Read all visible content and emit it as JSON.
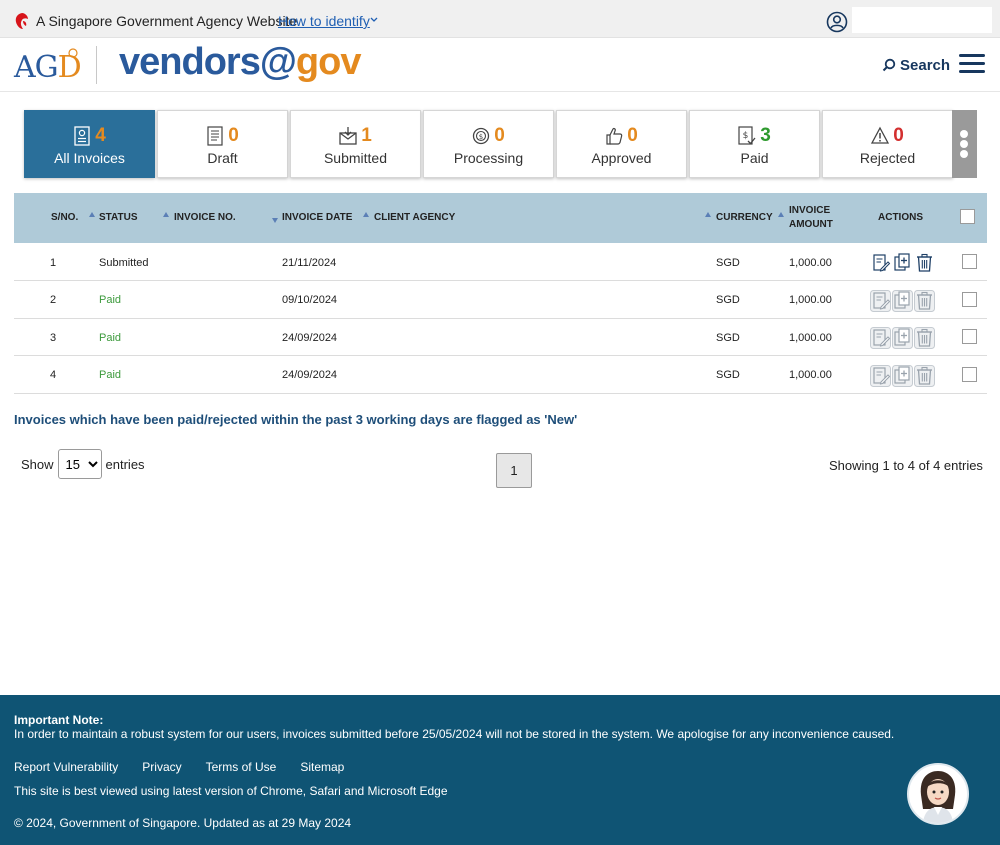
{
  "masthead": {
    "gov_text": "A Singapore Government Agency Website",
    "howto_label": "How to identify"
  },
  "header": {
    "logo_agd": "AG",
    "logo_agd_d": "D",
    "brand_part1": "vendors@",
    "brand_part2": "gov",
    "search_label": "Search"
  },
  "tabs": [
    {
      "label": "All Invoices",
      "count": "4",
      "active": true,
      "icon": "all-invoices-icon",
      "count_color": "#e48a1f"
    },
    {
      "label": "Draft",
      "count": "0",
      "icon": "draft-icon",
      "count_color": "#e48a1f"
    },
    {
      "label": "Submitted",
      "count": "1",
      "icon": "submitted-icon",
      "count_color": "#e48a1f"
    },
    {
      "label": "Processing",
      "count": "0",
      "icon": "processing-icon",
      "count_color": "#e48a1f"
    },
    {
      "label": "Approved",
      "count": "0",
      "icon": "approved-icon",
      "count_color": "#e48a1f"
    },
    {
      "label": "Paid",
      "count": "3",
      "icon": "paid-icon",
      "count_color": "#2e9a2e"
    },
    {
      "label": "Rejected",
      "count": "0",
      "icon": "rejected-icon",
      "count_color": "#d32f2f"
    }
  ],
  "table": {
    "headers": {
      "sno": "S/NO.",
      "status": "STATUS",
      "invoice_no": "INVOICE NO.",
      "invoice_date": "INVOICE DATE",
      "client_agency": "CLIENT AGENCY",
      "currency": "CURRENCY",
      "invoice_amount_1": "INVOICE",
      "invoice_amount_2": "AMOUNT",
      "actions": "ACTIONS"
    },
    "rows": [
      {
        "sno": "1",
        "status": "Submitted",
        "invoice_no": "",
        "invoice_date": "21/11/2024",
        "client_agency": "",
        "currency": "SGD",
        "amount": "1,000.00"
      },
      {
        "sno": "2",
        "status": "Paid",
        "invoice_no": "",
        "invoice_date": "09/10/2024",
        "client_agency": "",
        "currency": "SGD",
        "amount": "1,000.00"
      },
      {
        "sno": "3",
        "status": "Paid",
        "invoice_no": "",
        "invoice_date": "24/09/2024",
        "client_agency": "",
        "currency": "SGD",
        "amount": "1,000.00"
      },
      {
        "sno": "4",
        "status": "Paid",
        "invoice_no": "",
        "invoice_date": "24/09/2024",
        "client_agency": "",
        "currency": "SGD",
        "amount": "1,000.00"
      }
    ]
  },
  "flag_note": "Invoices which have been paid/rejected within the past 3 working days are flagged as 'New'",
  "pagination": {
    "show_label": "Show",
    "entries_label": "entries",
    "page_size": "15",
    "page_size_options": [
      "15"
    ],
    "current_page": "1",
    "showing_text": "Showing 1 to 4 of 4 entries"
  },
  "footer": {
    "note_title": "Important Note:",
    "note_text": "In order to maintain a robust system for our users, invoices submitted before 25/05/2024 will not be stored in the system. We apologise for any inconvenience caused.",
    "links": [
      "Report Vulnerability",
      "Privacy",
      "Terms of Use",
      "Sitemap"
    ],
    "browser_note": "This site is best viewed using latest version of Chrome, Safari and Microsoft Edge",
    "copyright": "© 2024, Government of Singapore. Updated as at 29 May 2024"
  },
  "colors": {
    "accent_blue": "#2a6f9a",
    "brand_orange": "#e48a1f",
    "footer_bg": "#0f5474",
    "paid_green": "#3c9a3c",
    "table_header_bg": "#afcad8"
  }
}
